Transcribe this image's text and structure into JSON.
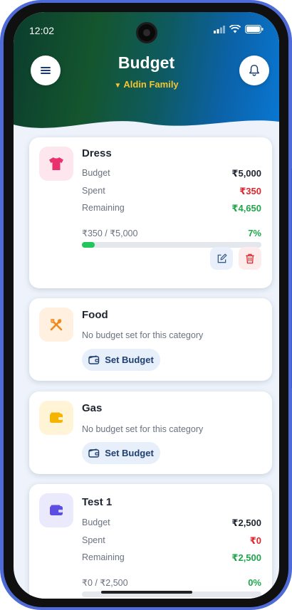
{
  "status": {
    "time": "12:02",
    "signal_icon": "signal-icon",
    "wifi_icon": "wifi-icon",
    "battery_icon": "battery-icon"
  },
  "header": {
    "title": "Budget",
    "family": "Aldin Family",
    "dropdown_icon": "▼",
    "menu_icon": "menu-icon",
    "bell_icon": "bell-icon"
  },
  "colors": {
    "accent_green": "#22c55e",
    "spent_red": "#e0252b",
    "remaining_green": "#1ea64a",
    "header_start": "#0b3d2e",
    "header_end": "#0a78d4"
  },
  "categories": [
    {
      "name": "Dress",
      "icon": "shirt-icon",
      "budget_label": "Budget",
      "budget": "₹5,000",
      "spent_label": "Spent",
      "spent": "₹350",
      "remaining_label": "Remaining",
      "remaining": "₹4,650",
      "progress_text": "₹350 / ₹5,000",
      "percent": "7%",
      "progress": 0.07,
      "edit_icon": "edit-icon",
      "delete_icon": "trash-icon"
    },
    {
      "name": "Food",
      "icon": "utensils-icon",
      "message": "No budget set for this category",
      "button": "Set Budget",
      "button_icon": "wallet-icon"
    },
    {
      "name": "Gas",
      "icon": "wallet-icon",
      "message": "No budget set for this category",
      "button": "Set Budget",
      "button_icon": "wallet-icon"
    },
    {
      "name": "Test 1",
      "icon": "wallet-icon",
      "budget_label": "Budget",
      "budget": "₹2,500",
      "spent_label": "Spent",
      "spent": "₹0",
      "remaining_label": "Remaining",
      "remaining": "₹2,500",
      "progress_text": "₹0 / ₹2,500",
      "percent": "0%",
      "progress": 0
    }
  ]
}
